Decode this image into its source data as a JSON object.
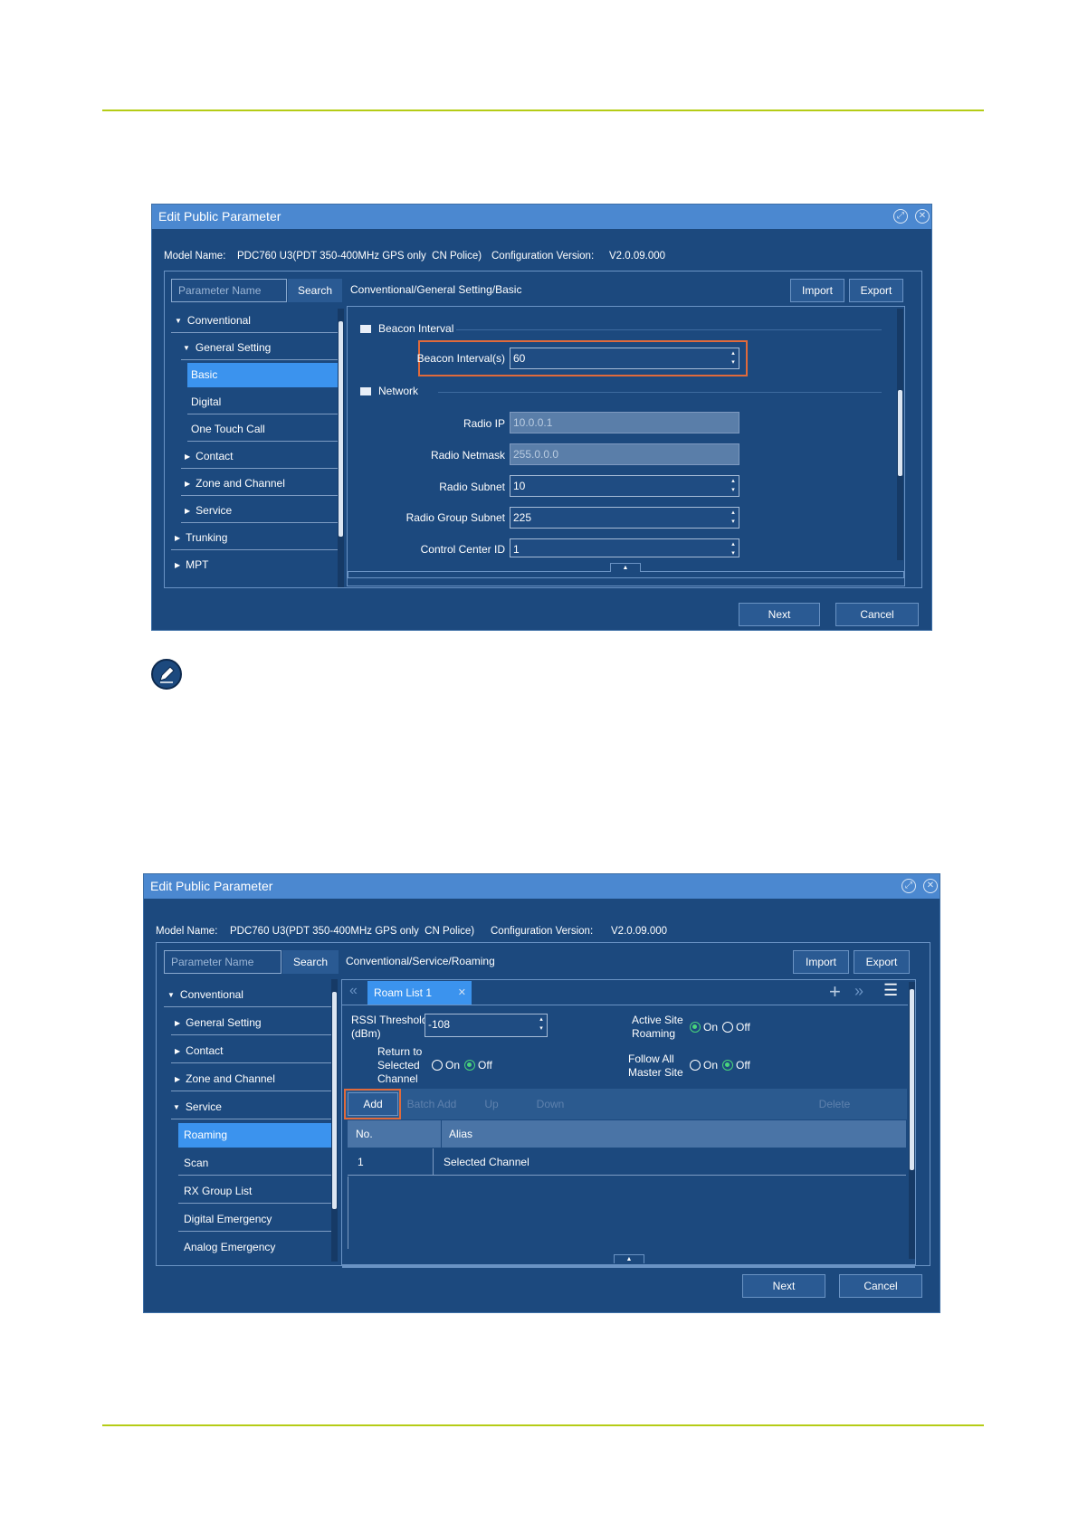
{
  "screenshot1": {
    "title": "Edit Public Parameter",
    "model_label": "Model Name:",
    "model_value": "PDC760 U3(PDT 350-400MHz GPS only  CN Police)",
    "config_label": "Configuration Version:",
    "config_value": "V2.0.09.000",
    "search_placeholder": "Parameter Name",
    "search_label": "Search",
    "path": "Conventional/General Setting/Basic",
    "import_label": "Import",
    "export_label": "Export",
    "tree": [
      "Conventional",
      "General Setting",
      "Basic",
      "Digital",
      "One Touch Call",
      "Contact",
      "Zone and Channel",
      "Service",
      "Trunking",
      "MPT"
    ],
    "section_beacon": "Beacon Interval",
    "section_network": "Network",
    "fields": [
      {
        "label": "Beacon Interval(s)",
        "value": "60"
      },
      {
        "label": "Radio IP",
        "value": "10.0.0.1"
      },
      {
        "label": "Radio Netmask",
        "value": "255.0.0.0"
      },
      {
        "label": "Radio Subnet",
        "value": "10"
      },
      {
        "label": "Radio Group Subnet",
        "value": "225"
      },
      {
        "label": "Control Center ID",
        "value": "1"
      }
    ],
    "next_label": "Next",
    "cancel_label": "Cancel"
  },
  "screenshot2": {
    "title": "Edit Public Parameter",
    "model_label": "Model Name:",
    "model_value": "PDC760 U3(PDT 350-400MHz GPS only  CN Police)",
    "config_label": "Configuration Version:",
    "config_value": "V2.0.09.000",
    "search_placeholder": "Parameter Name",
    "search_label": "Search",
    "path": "Conventional/Service/Roaming",
    "import_label": "Import",
    "export_label": "Export",
    "tree": [
      "Conventional",
      "General Setting",
      "Contact",
      "Zone and Channel",
      "Service",
      "Roaming",
      "Scan",
      "RX Group List",
      "Digital Emergency",
      "Analog Emergency"
    ],
    "tab_label": "Roam List 1",
    "rssi_label_1": "RSSI Threshold",
    "rssi_label_2": "(dBm)",
    "rssi_value": "-108",
    "active_site_1": "Active Site",
    "active_site_2": "Roaming",
    "return_1": "Return to",
    "return_2": "Selected",
    "return_3": "Channel",
    "follow_1": "Follow All",
    "follow_2": "Master Site",
    "on_label": "On",
    "off_label": "Off",
    "toolbar": [
      "Add",
      "Batch Add",
      "Up",
      "Down",
      "Delete"
    ],
    "table_headers": [
      "No.",
      "Alias"
    ],
    "table_rows": [
      [
        "1",
        "Selected Channel"
      ]
    ],
    "next_label": "Next",
    "cancel_label": "Cancel"
  }
}
